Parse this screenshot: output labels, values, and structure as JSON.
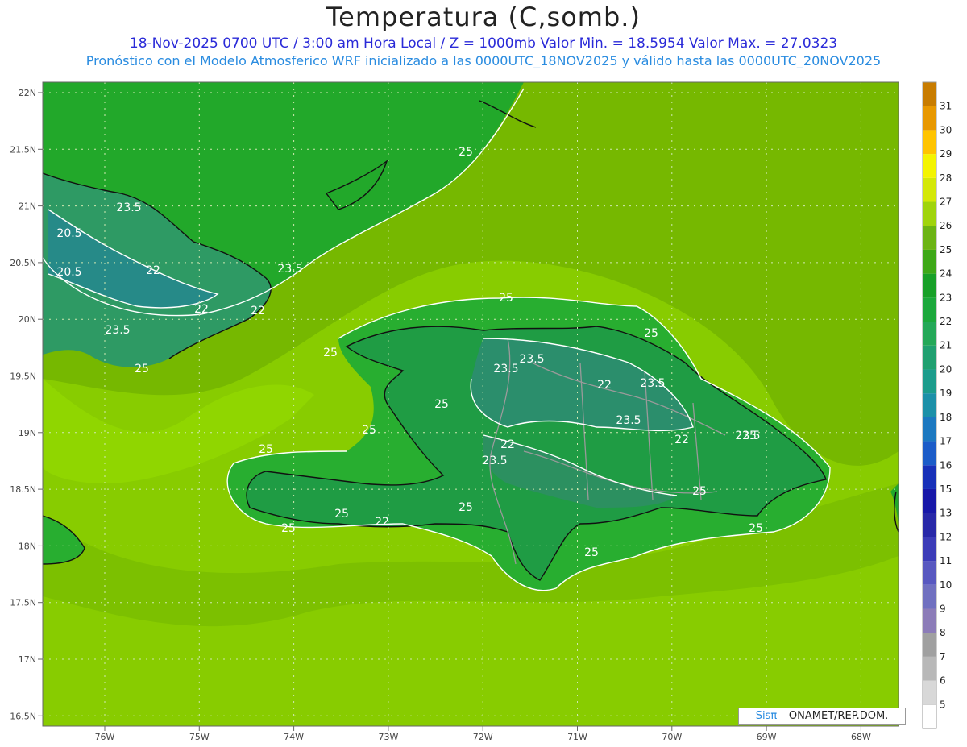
{
  "title": "Temperatura (C,somb.)",
  "subtitle_1": "18-Nov-2025  0700 UTC / 3:00 am Hora Local / Z = 1000mb    Valor Min. = 18.5954  Valor Max. = 27.0323",
  "subtitle_2": "Pronóstico con el Modelo Atmosferico WRF inicializado a las 0000UTC_18NOV2025 y válido hasta las  0000UTC_20NOV2025",
  "credit": {
    "brand": "Sisπ",
    "text": " – ONAMET/REP.DOM."
  },
  "lat_labels": [
    "22N",
    "21.5N",
    "21N",
    "20.5N",
    "20N",
    "19.5N",
    "19N",
    "18.5N",
    "18N",
    "17.5N",
    "17N",
    "16.5N"
  ],
  "lon_labels": [
    "76W",
    "75W",
    "74W",
    "73W",
    "72W",
    "71W",
    "70W",
    "69W",
    "68W"
  ],
  "colorbar": {
    "levels": [
      "5",
      "6",
      "7",
      "8",
      "9",
      "10",
      "11",
      "12",
      "13",
      "15",
      "16",
      "17",
      "18",
      "19",
      "20",
      "21",
      "22",
      "23",
      "24",
      "25",
      "26",
      "27",
      "28",
      "29",
      "30",
      "31"
    ],
    "colors": [
      "#ffffff",
      "#d8d8d8",
      "#b8b8b8",
      "#a0a0a0",
      "#8c7cb8",
      "#7070c0",
      "#5858c0",
      "#3c3cb8",
      "#2828a8",
      "#1818a8",
      "#1830b8",
      "#1c5cc8",
      "#1c78c0",
      "#1c90a8",
      "#1c9c8c",
      "#20a070",
      "#24a858",
      "#1ca83c",
      "#18a028",
      "#3ea818",
      "#6cb414",
      "#a0d40c",
      "#d4e808",
      "#f4f400",
      "#ffc400",
      "#e89800",
      "#c87c00"
    ]
  },
  "contour_labels": [
    "25",
    "23.5",
    "20.5",
    "22",
    "20.5",
    "22",
    "23.5",
    "22",
    "23.5",
    "25",
    "25",
    "25",
    "25",
    "23.5",
    "22",
    "23.5",
    "25",
    "25",
    "23.5",
    "22",
    "23.5",
    "22",
    "25",
    "25",
    "25",
    "25",
    "25",
    "25",
    "23.5",
    "22",
    "23.5",
    "25",
    "25"
  ],
  "colors": {
    "sea": "#8cd400",
    "sea_deep": "#7cc200",
    "land_warm": "#22a82a",
    "land_cool": "#2e9a70",
    "coast": "#111111",
    "border": "#999999"
  }
}
